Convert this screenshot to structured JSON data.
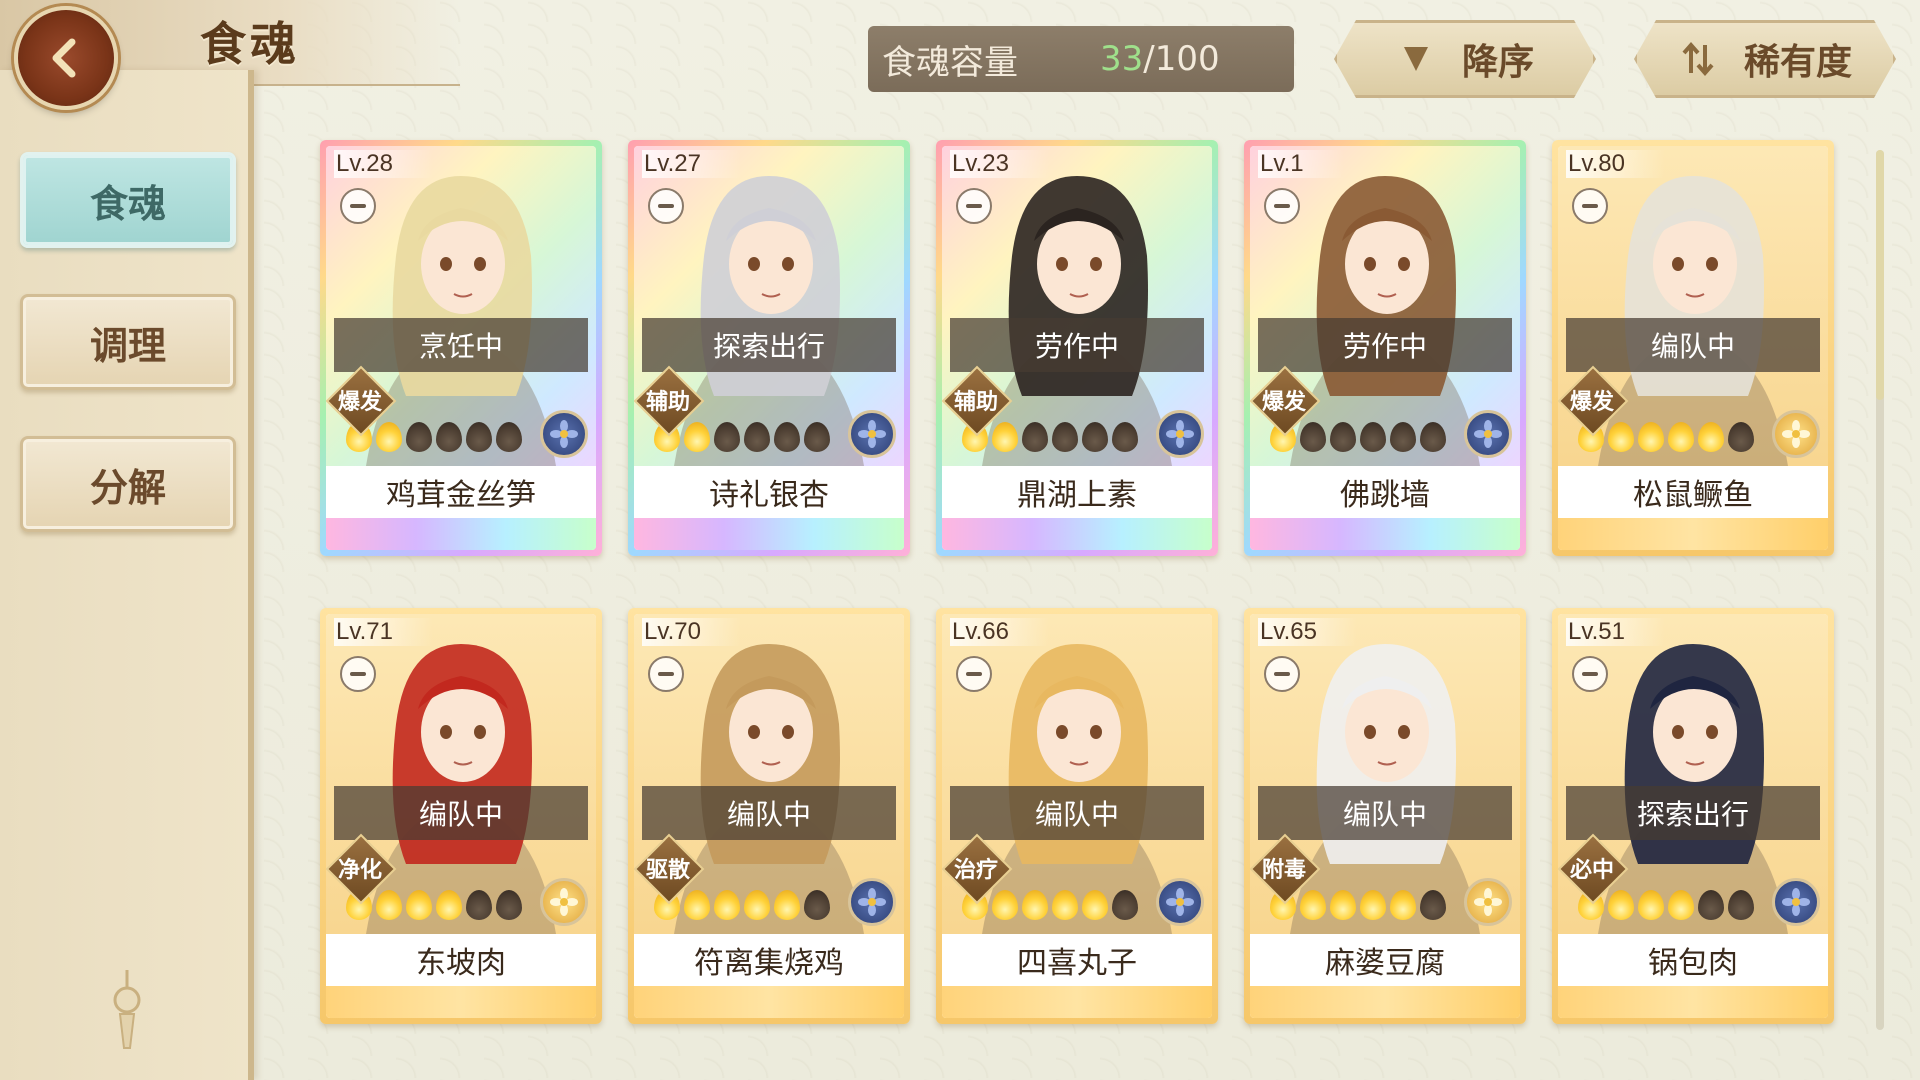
{
  "header": {
    "title": "食魂",
    "capacity_label": "食魂容量",
    "capacity_current": "33",
    "capacity_sep": "/",
    "capacity_max": "100"
  },
  "sort": {
    "order_label": "降序",
    "rarity_label": "稀有度"
  },
  "sidebar": {
    "items": [
      {
        "label": "食魂",
        "active": true
      },
      {
        "label": "调理",
        "active": false
      },
      {
        "label": "分解",
        "active": false
      }
    ]
  },
  "cards": [
    {
      "level": "Lv.28",
      "status": "烹饪中",
      "role": "爆发",
      "name": "鸡茸金丝笋",
      "frame": "rainbow",
      "emblem": "blue",
      "stars": 2,
      "hair": "#e9d9a0"
    },
    {
      "level": "Lv.27",
      "status": "探索出行",
      "role": "辅助",
      "name": "诗礼银杏",
      "frame": "rainbow",
      "emblem": "blue",
      "stars": 2,
      "hair": "#cfcfd6"
    },
    {
      "level": "Lv.23",
      "status": "劳作中",
      "role": "辅助",
      "name": "鼎湖上素",
      "frame": "rainbow",
      "emblem": "blue",
      "stars": 2,
      "hair": "#2b2420"
    },
    {
      "level": "Lv.1",
      "status": "劳作中",
      "role": "爆发",
      "name": "佛跳墙",
      "frame": "rainbow",
      "emblem": "blue",
      "stars": 1,
      "hair": "#8a5a34"
    },
    {
      "level": "Lv.80",
      "status": "编队中",
      "role": "爆发",
      "name": "松鼠鳜鱼",
      "frame": "gold",
      "emblem": "gold",
      "stars": 5,
      "hair": "#e6e2d8"
    },
    {
      "level": "Lv.71",
      "status": "编队中",
      "role": "净化",
      "name": "东坡肉",
      "frame": "gold",
      "emblem": "gold",
      "stars": 4,
      "hair": "#c2281e"
    },
    {
      "level": "Lv.70",
      "status": "编队中",
      "role": "驱散",
      "name": "符离集烧鸡",
      "frame": "gold",
      "emblem": "blue",
      "stars": 5,
      "hair": "#c49a5c"
    },
    {
      "level": "Lv.66",
      "status": "编队中",
      "role": "治疗",
      "name": "四喜丸子",
      "frame": "gold",
      "emblem": "blue",
      "stars": 5,
      "hair": "#e8b860"
    },
    {
      "level": "Lv.65",
      "status": "编队中",
      "role": "附毒",
      "name": "麻婆豆腐",
      "frame": "gold",
      "emblem": "gold",
      "stars": 5,
      "hair": "#efefef"
    },
    {
      "level": "Lv.51",
      "status": "探索出行",
      "role": "必中",
      "name": "锅包肉",
      "frame": "gold",
      "emblem": "blue",
      "stars": 4,
      "hair": "#1f2540"
    }
  ]
}
